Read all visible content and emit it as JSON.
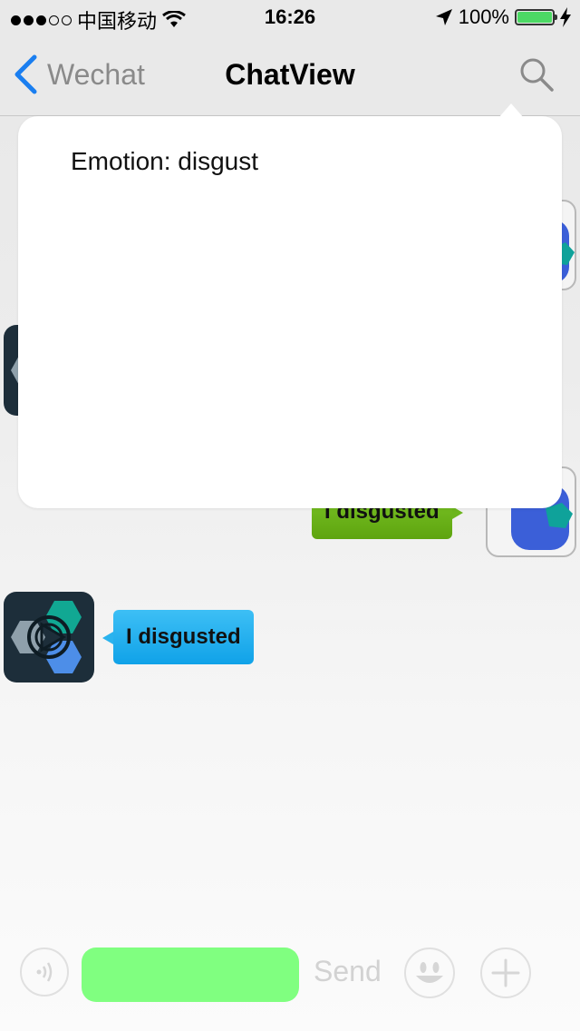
{
  "status_bar": {
    "carrier": "中国移动",
    "time": "16:26",
    "battery": "100%"
  },
  "nav": {
    "back_label": "Wechat",
    "title": "ChatView"
  },
  "popover": {
    "text": "Emotion: disgust"
  },
  "messages": [
    {
      "side": "right",
      "text": "I disgusted"
    },
    {
      "side": "left",
      "text": "I disgusted"
    }
  ],
  "input": {
    "send_label": "Send"
  },
  "colors": {
    "accent": "#1a7ef0",
    "bubble_blue": "#1faaf0",
    "bubble_green": "#6cb51c",
    "record_button": "#80ff80"
  },
  "icons": [
    "back-chevron-icon",
    "search-icon",
    "wifi-icon",
    "location-arrow-icon",
    "charging-bolt-icon",
    "voice-icon",
    "emoji-icon",
    "plus-icon"
  ]
}
